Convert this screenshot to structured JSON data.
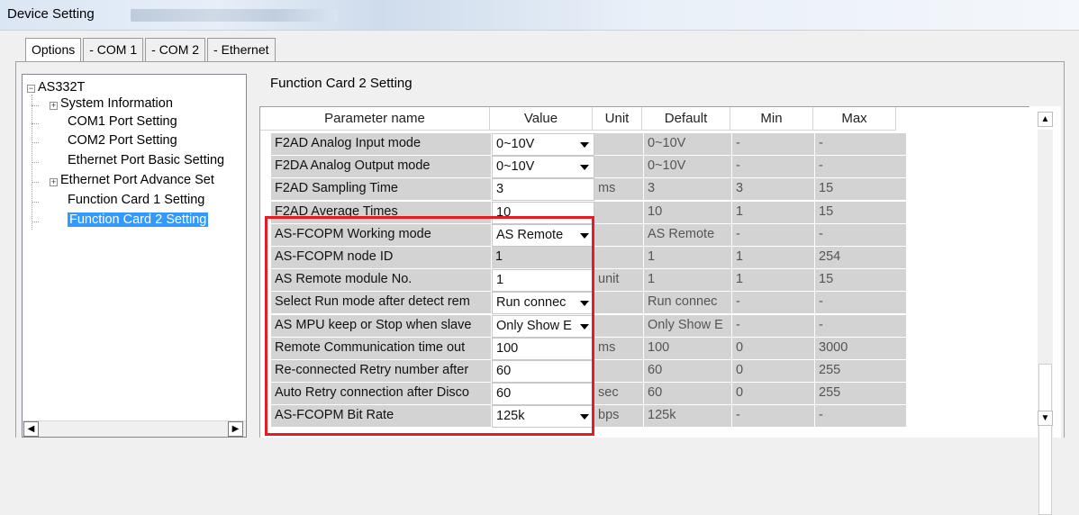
{
  "window": {
    "title": "Device Setting"
  },
  "tabs": [
    "Options",
    "- COM 1",
    "- COM 2",
    "- Ethernet"
  ],
  "tree": {
    "root": "AS332T",
    "items": [
      {
        "label": "System Information",
        "expandable": true
      },
      {
        "label": "COM1 Port Setting",
        "expandable": false
      },
      {
        "label": "COM2 Port Setting",
        "expandable": false
      },
      {
        "label": "Ethernet Port Basic Setting",
        "expandable": false
      },
      {
        "label": "Ethernet Port Advance Set",
        "expandable": true
      },
      {
        "label": "Function Card 1 Setting",
        "expandable": false
      },
      {
        "label": "Function Card 2 Setting",
        "expandable": false,
        "selected": true
      }
    ]
  },
  "section": {
    "title": "Function Card 2 Setting"
  },
  "grid": {
    "columns": [
      "Parameter name",
      "Value",
      "Unit",
      "Default",
      "Min",
      "Max"
    ],
    "rows": [
      {
        "name": "F2AD Analog Input mode",
        "value": "0~10V",
        "dropdown": true,
        "editable": true,
        "unit": "",
        "default": "0~10V",
        "min": "-",
        "max": "-"
      },
      {
        "name": "F2DA Analog Output mode",
        "value": "0~10V",
        "dropdown": true,
        "editable": true,
        "unit": "",
        "default": "0~10V",
        "min": "-",
        "max": "-"
      },
      {
        "name": "F2AD Sampling Time",
        "value": "3",
        "dropdown": false,
        "editable": true,
        "unit": "ms",
        "default": "3",
        "min": "3",
        "max": "15"
      },
      {
        "name": "F2AD Average Times",
        "value": "10",
        "dropdown": false,
        "editable": true,
        "unit": "",
        "default": "10",
        "min": "1",
        "max": "15"
      },
      {
        "name": "AS-FCOPM Working mode",
        "value": "AS Remote",
        "dropdown": true,
        "editable": true,
        "unit": "",
        "default": "AS Remote",
        "min": "-",
        "max": "-"
      },
      {
        "name": "AS-FCOPM node ID",
        "value": "1",
        "dropdown": false,
        "editable": false,
        "unit": "",
        "default": "1",
        "min": "1",
        "max": "254"
      },
      {
        "name": "AS Remote module No.",
        "value": "1",
        "dropdown": false,
        "editable": true,
        "unit": "unit",
        "default": "1",
        "min": "1",
        "max": "15"
      },
      {
        "name": "Select Run mode after detect rem",
        "value": "Run connec",
        "dropdown": true,
        "editable": true,
        "unit": "",
        "default": "Run connec",
        "min": "-",
        "max": "-"
      },
      {
        "name": "AS MPU keep or Stop when slave",
        "value": "Only Show E",
        "dropdown": true,
        "editable": true,
        "unit": "",
        "default": "Only Show E",
        "min": "-",
        "max": "-"
      },
      {
        "name": "Remote Communication time out",
        "value": "100",
        "dropdown": false,
        "editable": true,
        "unit": "ms",
        "default": "100",
        "min": "0",
        "max": "3000"
      },
      {
        "name": "Re-connected Retry number after",
        "value": "60",
        "dropdown": false,
        "editable": true,
        "unit": "",
        "default": "60",
        "min": "0",
        "max": "255"
      },
      {
        "name": "Auto Retry connection after Disco",
        "value": "60",
        "dropdown": false,
        "editable": true,
        "unit": "sec",
        "default": "60",
        "min": "0",
        "max": "255"
      },
      {
        "name": "AS-FCOPM Bit Rate",
        "value": "125k",
        "dropdown": true,
        "editable": true,
        "unit": "bps",
        "default": "125k",
        "min": "-",
        "max": "-"
      }
    ]
  },
  "colors": {
    "highlight": "#e51c23",
    "selection": "#3399ff",
    "readonly_cell": "#d3d3d3"
  }
}
